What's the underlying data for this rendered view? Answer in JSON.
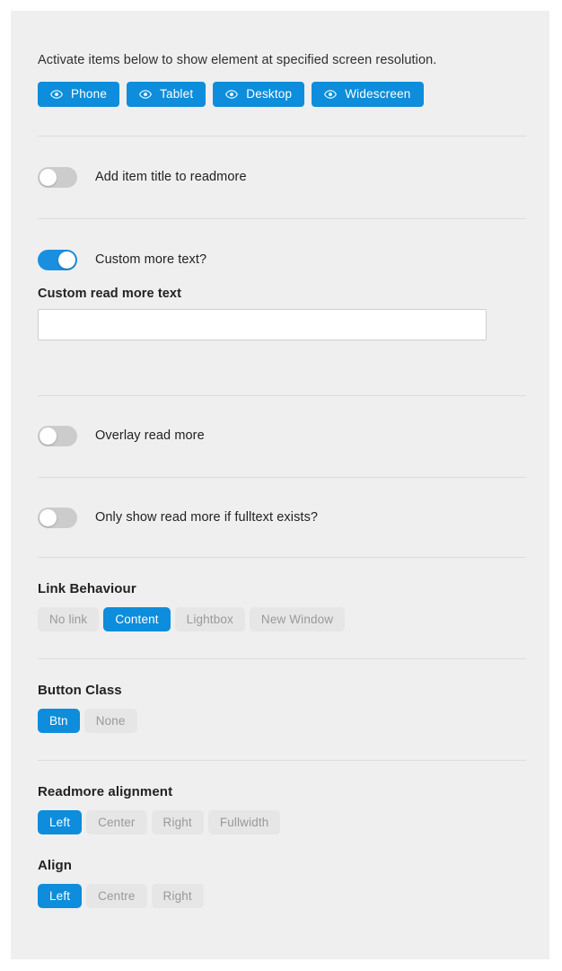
{
  "resolution_section": {
    "description": "Activate items below to show element at specified screen resolution.",
    "buttons": [
      {
        "label": "Phone",
        "icon": "eye-icon",
        "state": "active"
      },
      {
        "label": "Tablet",
        "icon": "eye-icon",
        "state": "active"
      },
      {
        "label": "Desktop",
        "icon": "eye-icon",
        "state": "active"
      },
      {
        "label": "Widescreen",
        "icon": "eye-icon",
        "state": "active"
      }
    ]
  },
  "toggles": [
    {
      "label": "Add item title to readmore",
      "state": "off"
    },
    {
      "label": "Custom more text?",
      "state": "on"
    },
    {
      "label": "Overlay read more",
      "state": "off"
    },
    {
      "label": "Only show read more if fulltext exists?",
      "state": "off"
    }
  ],
  "custom_text_field": {
    "label": "Custom read more text",
    "value": "",
    "placeholder": ""
  },
  "link_behaviour": {
    "heading": "Link Behaviour",
    "options": [
      {
        "label": "No link",
        "selected": false
      },
      {
        "label": "Content",
        "selected": true
      },
      {
        "label": "Lightbox",
        "selected": false
      },
      {
        "label": "New Window",
        "selected": false
      }
    ]
  },
  "button_class": {
    "heading": "Button Class",
    "options": [
      {
        "label": "Btn",
        "selected": true
      },
      {
        "label": "None",
        "selected": false
      }
    ]
  },
  "readmore_alignment": {
    "heading": "Readmore alignment",
    "options": [
      {
        "label": "Left",
        "selected": true
      },
      {
        "label": "Center",
        "selected": false
      },
      {
        "label": "Right",
        "selected": false
      },
      {
        "label": "Fullwidth",
        "selected": false
      }
    ]
  },
  "align": {
    "heading": "Align",
    "options": [
      {
        "label": "Left",
        "selected": true
      },
      {
        "label": "Centre",
        "selected": false
      },
      {
        "label": "Right",
        "selected": false
      }
    ]
  },
  "colors": {
    "accent": "#0d8ddb",
    "toggle_on": "#1a8fe0",
    "toggle_off": "#cccccc",
    "panel_bg": "#efefef",
    "divider": "#dcdcdc",
    "inactive_btn_bg": "#e6e6e6",
    "inactive_btn_text": "#999999"
  }
}
